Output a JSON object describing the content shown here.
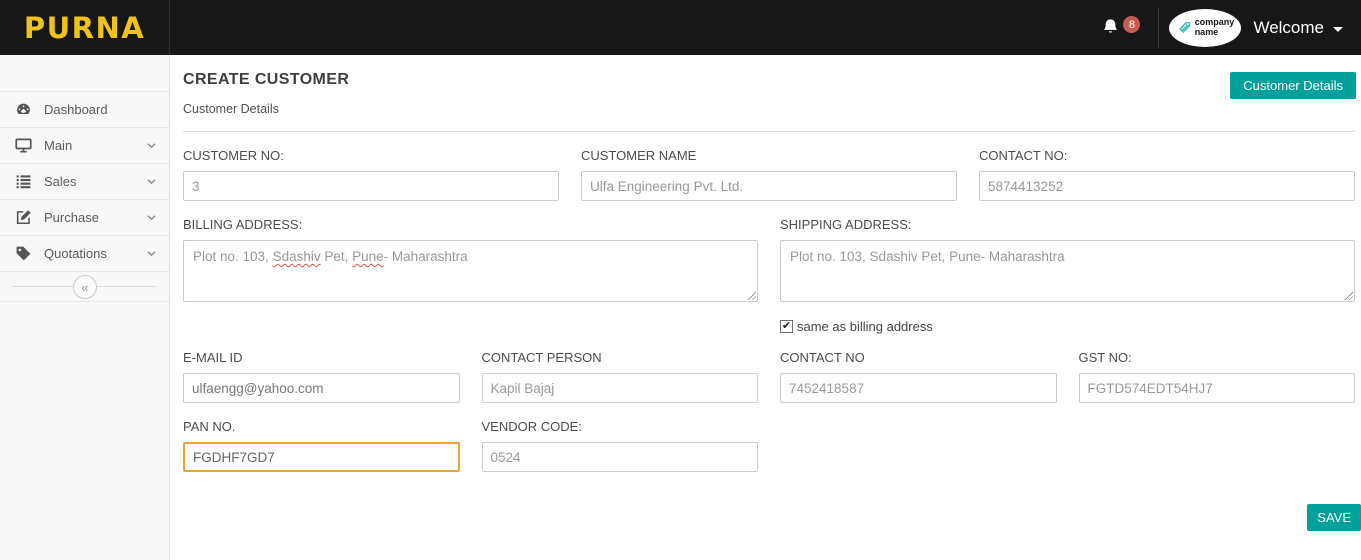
{
  "header": {
    "brand": "PURNA",
    "notification_count": "8",
    "company_logo_line1": "company",
    "company_logo_line2": "name",
    "welcome_label": "Welcome"
  },
  "sidebar": {
    "items": [
      {
        "label": "Dashboard",
        "icon": "dashboard-icon",
        "has_submenu": false
      },
      {
        "label": "Main",
        "icon": "monitor-icon",
        "has_submenu": true
      },
      {
        "label": "Sales",
        "icon": "list-icon",
        "has_submenu": true
      },
      {
        "label": "Purchase",
        "icon": "edit-icon",
        "has_submenu": true
      },
      {
        "label": "Quotations",
        "icon": "tag-icon",
        "has_submenu": true
      }
    ],
    "collapse_glyph": "«"
  },
  "page": {
    "title": "CREATE CUSTOMER",
    "breadcrumb": "Customer Details",
    "details_button_label": "Customer Details",
    "save_button_label": "SAVE"
  },
  "form": {
    "customer_no": {
      "label": "CUSTOMER NO:",
      "value": "3"
    },
    "customer_name": {
      "label": "CUSTOMER NAME",
      "value": "Ulfa Engineering Pvt. Ltd."
    },
    "contact_no_top": {
      "label": "CONTACT NO:",
      "value": "5874413252"
    },
    "billing_address": {
      "label": "BILLING ADDRESS:",
      "value": "Plot no. 103, Sdashiv Pet, Pune- Maharashtra",
      "segments": [
        {
          "text": "Plot no. 103, "
        },
        {
          "text": "Sdashiv",
          "misspelled": true
        },
        {
          "text": " Pet, "
        },
        {
          "text": "Pune",
          "misspelled": true
        },
        {
          "text": "- Maharashtra"
        }
      ]
    },
    "shipping_address": {
      "label": "SHIPPING ADDRESS:",
      "value": "Plot no. 103, Sdashiv Pet, Pune- Maharashtra"
    },
    "same_as_billing": {
      "label": "same as billing address",
      "checked": true
    },
    "email": {
      "label": "E-MAIL ID",
      "value": "ulfaengg@yahoo.com"
    },
    "contact_person": {
      "label": "CONTACT PERSON",
      "value": "Kapil Bajaj"
    },
    "contact_no_bottom": {
      "label": "CONTACT NO",
      "value": "7452418587"
    },
    "gst_no": {
      "label": "GST NO:",
      "value": "FGTD574EDT54HJ7"
    },
    "pan_no": {
      "label": "PAN NO.",
      "value": "FGDHF7GD7"
    },
    "vendor_code": {
      "label": "VENDOR CODE:",
      "value": "0524"
    }
  },
  "colors": {
    "accent_teal": "#00a19a",
    "brand_yellow": "#efc319",
    "badge_red": "#c95a52",
    "focus_orange": "#eda33c"
  }
}
